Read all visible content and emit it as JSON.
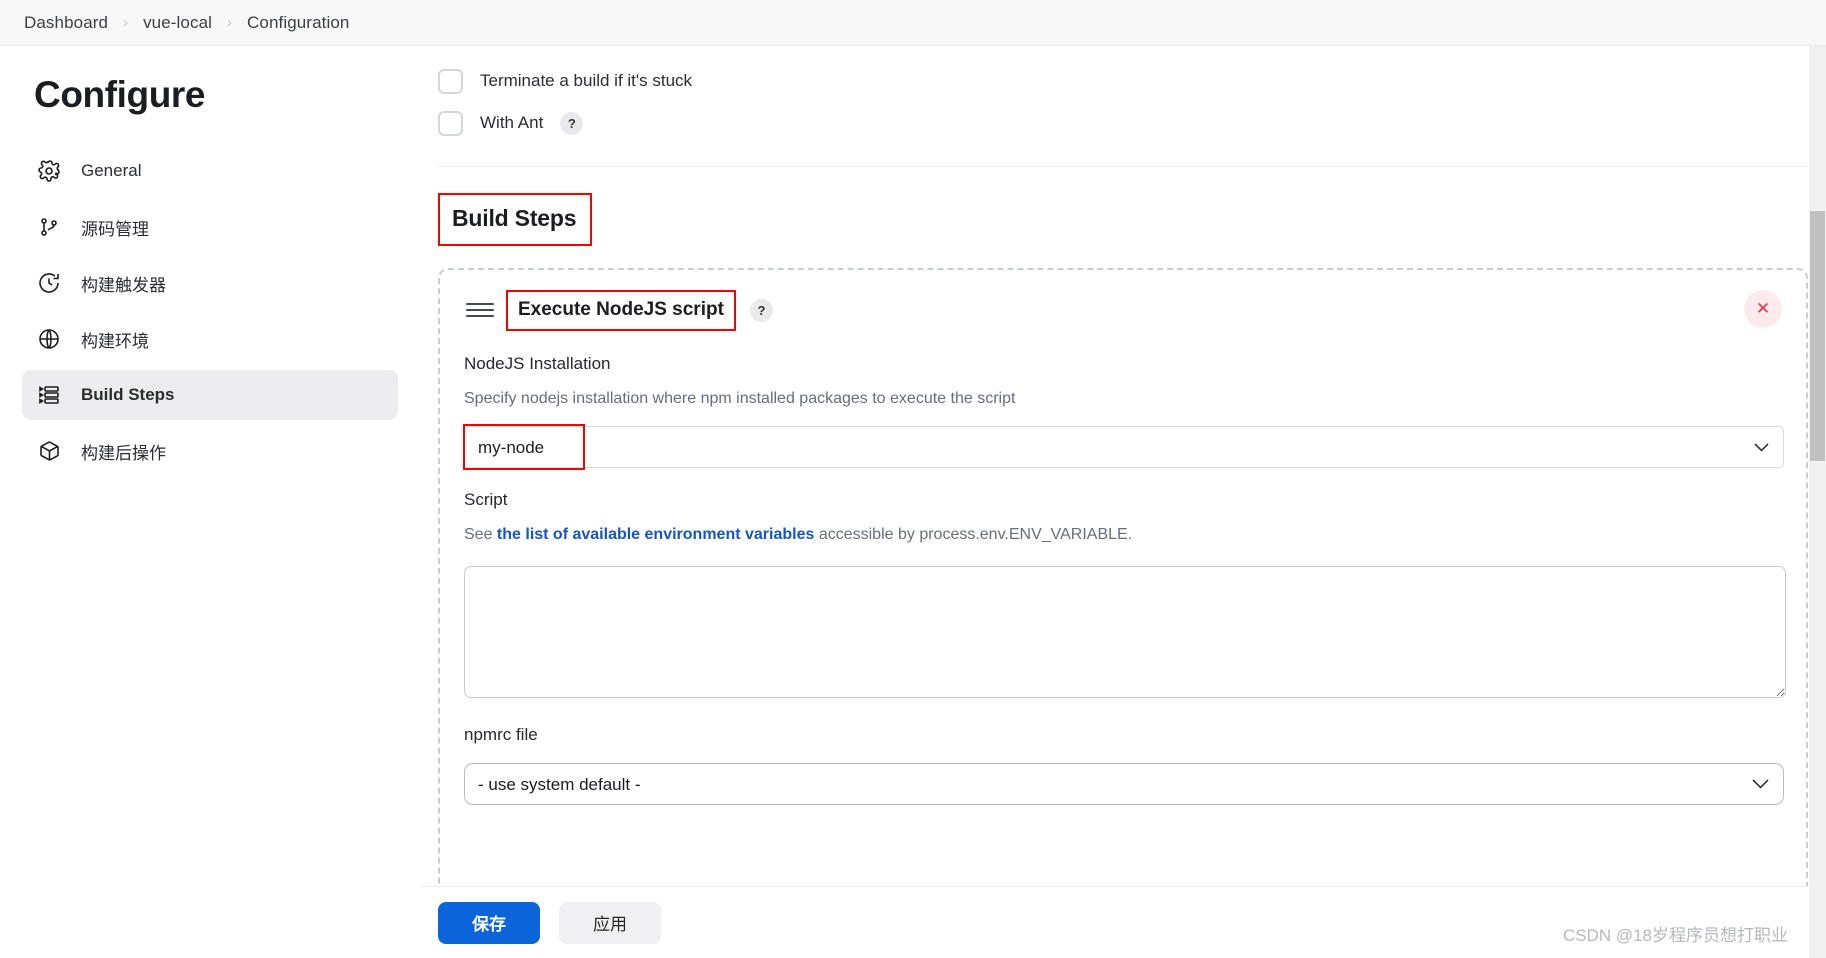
{
  "breadcrumb": {
    "items": [
      "Dashboard",
      "vue-local",
      "Configuration"
    ],
    "separator": "›"
  },
  "sidebar": {
    "title": "Configure",
    "items": [
      {
        "label": "General",
        "icon": "gear-icon",
        "active": false
      },
      {
        "label": "源码管理",
        "icon": "branch-icon",
        "active": false
      },
      {
        "label": "构建触发器",
        "icon": "clock-icon",
        "active": false
      },
      {
        "label": "构建环境",
        "icon": "globe-icon",
        "active": false
      },
      {
        "label": "Build Steps",
        "icon": "list-steps-icon",
        "active": true
      },
      {
        "label": "构建后操作",
        "icon": "package-icon",
        "active": false
      }
    ]
  },
  "main": {
    "checkboxes": [
      {
        "label": "Terminate a build if it's stuck",
        "checked": false,
        "help": false
      },
      {
        "label": "With Ant",
        "checked": false,
        "help": true
      }
    ],
    "help_glyph": "?",
    "section_title": "Build Steps",
    "step": {
      "title": "Execute NodeJS script",
      "help_glyph": "?",
      "close_glyph": "✕",
      "installation_label": "NodeJS Installation",
      "installation_desc": "Specify nodejs installation where npm installed packages to execute the script",
      "installation_value": "my-node",
      "script_label": "Script",
      "script_prefix": "See ",
      "script_link": "the list of available environment variables",
      "script_suffix": " accessible by process.env.ENV_VARIABLE.",
      "script_value": "",
      "npmrc_label": "npmrc file",
      "npmrc_value": "- use system default -",
      "chevron_glyph": "⌵"
    }
  },
  "actions": {
    "save_label": "保存",
    "apply_label": "应用"
  },
  "watermark": "CSDN @18岁程序员想打职业",
  "colors": {
    "annotation_red": "#f00500",
    "primary_blue": "#0b64d9",
    "link_blue": "#1756c1",
    "active_bg": "#ededf0",
    "close_bg": "#fdeaec",
    "close_fg": "#e8303f"
  }
}
